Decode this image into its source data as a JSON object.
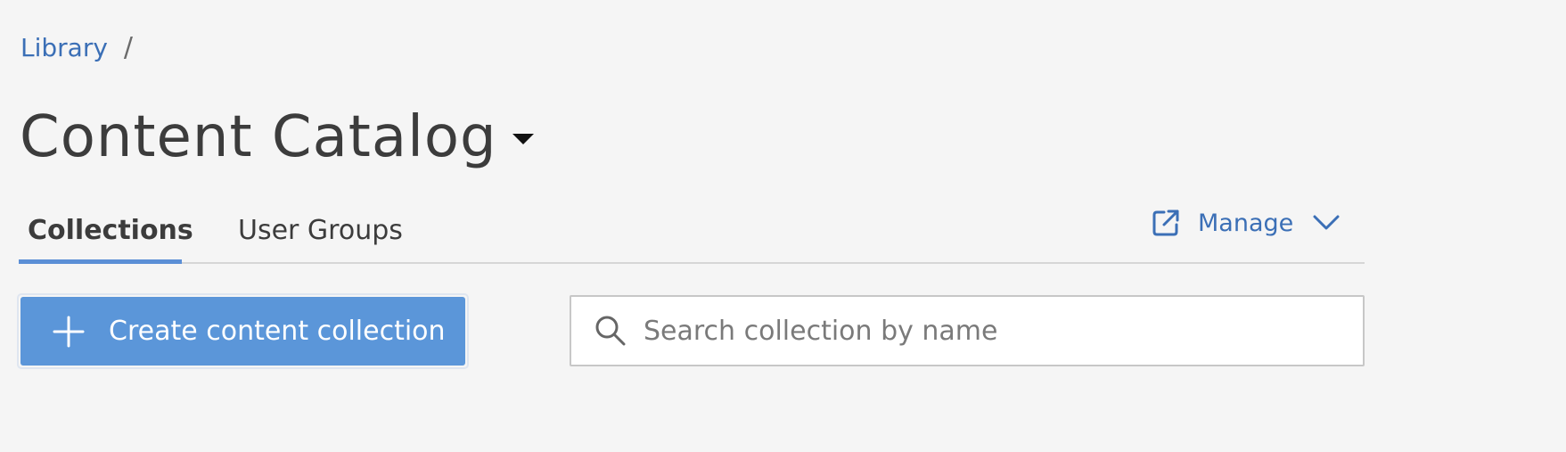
{
  "breadcrumb": {
    "items": [
      {
        "label": "Library"
      }
    ],
    "separator": "/"
  },
  "header": {
    "title": "Content Catalog",
    "title_menu_icon": "caret-down-icon"
  },
  "tabs": [
    {
      "label": "Collections",
      "active": true
    },
    {
      "label": "User Groups",
      "active": false
    }
  ],
  "manage": {
    "label": "Manage",
    "icon": "external-link-icon",
    "menu_icon": "chevron-down-icon"
  },
  "toolbar": {
    "create_label": "Create content collection",
    "create_icon": "plus-icon"
  },
  "search": {
    "placeholder": "Search collection by name",
    "value": "",
    "icon": "search-icon"
  },
  "colors": {
    "accent": "#5b96d9",
    "link": "#3b6fb6",
    "active_tab_underline": "#5b8fd6",
    "background": "#f5f5f5",
    "text": "#3c3c3c"
  }
}
